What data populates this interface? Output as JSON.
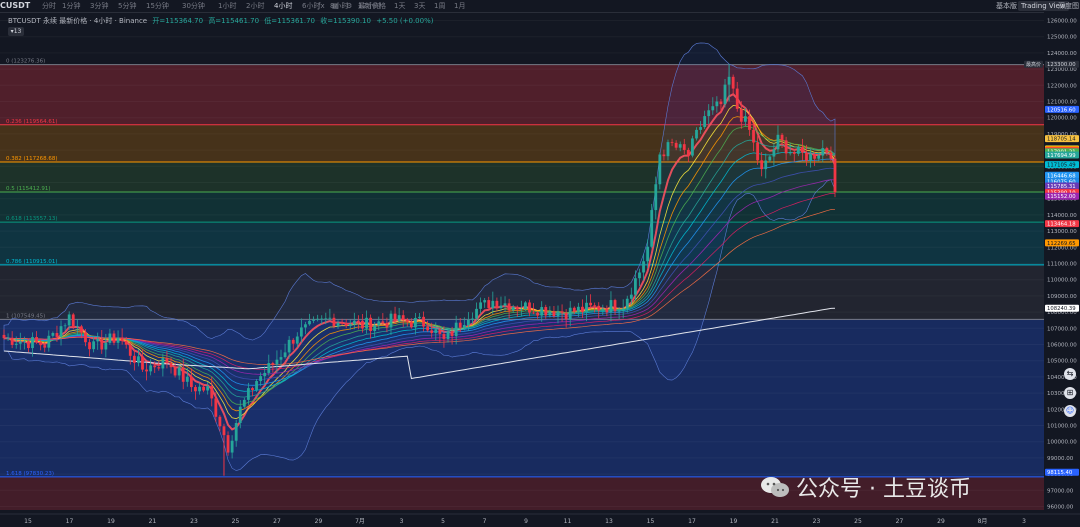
{
  "topbar": {
    "symbol": "CUSDT",
    "timeframes": [
      "分时",
      "1分钟",
      "3分钟",
      "5分钟",
      "15分钟",
      "30分钟",
      "1小时",
      "2小时",
      "4小时",
      "6小时",
      "8小时",
      "12小时",
      "1天",
      "3天",
      "1周",
      "1月"
    ],
    "active_timeframe": "4小时",
    "latest_price_menu": "最新价格",
    "right_basic": "基本版",
    "right_tradingview": "Trading View",
    "right_depth": "深度图"
  },
  "legend": {
    "pair": "BTCUSDT 永续 最新价格 · 4小时 · Binance",
    "open": "开=115364.70",
    "high": "高=115461.70",
    "low": "低=115361.70",
    "close": "收=115390.10",
    "change": "+5.50 (+0.00%)",
    "indicator_count": "13"
  },
  "fib_labels": [
    {
      "text": "0 (123276.36)",
      "price": 123276.36,
      "color": "#787b86"
    },
    {
      "text": "0.236 (119564.61)",
      "price": 119564.61,
      "color": "#f23645"
    },
    {
      "text": "0.382 (117268.68)",
      "price": 117268.68,
      "color": "#ff9800"
    },
    {
      "text": "0.5 (115412.91)",
      "price": 115412.91,
      "color": "#4caf50"
    },
    {
      "text": "0.618 (113557.13)",
      "price": 113557.13,
      "color": "#089981"
    },
    {
      "text": "0.786 (110915.01)",
      "price": 110915.01,
      "color": "#00bcd4"
    },
    {
      "text": "1 (107549.45)",
      "price": 107549.45,
      "color": "#787b86"
    },
    {
      "text": "1.618 (97830.23)",
      "price": 97830.23,
      "color": "#2962ff"
    }
  ],
  "price_scale": {
    "ticks": [
      "126000.00",
      "125000.00",
      "124000.00",
      "123000.00",
      "122000.00",
      "121000.00",
      "120000.00",
      "119000.00",
      "118000.00",
      "117000.00",
      "116000.00",
      "115000.00",
      "114000.00",
      "113000.00",
      "112000.00",
      "111000.00",
      "110000.00",
      "109000.00",
      "108000.00",
      "107000.00",
      "106000.00",
      "105000.00",
      "104000.00",
      "103000.00",
      "102000.00",
      "101000.00",
      "100000.00",
      "99000.00",
      "98000.00",
      "97000.00",
      "96000.00"
    ],
    "tick_prices": [
      126000,
      125000,
      124000,
      123000,
      122000,
      121000,
      120000,
      119000,
      118000,
      117000,
      116000,
      115000,
      114000,
      113000,
      112000,
      111000,
      110000,
      109000,
      108000,
      107000,
      106000,
      105000,
      104000,
      103000,
      102000,
      101000,
      100000,
      99000,
      98000,
      97000,
      96000
    ],
    "max_label": "最高价",
    "badges": [
      {
        "text": "123300.00",
        "price": 123300.0,
        "bg": "#2a2e39",
        "fg": "#d1d4dc"
      },
      {
        "text": "120516.60",
        "price": 120516.6,
        "bg": "#2962ff",
        "fg": "#ffffff"
      },
      {
        "text": "118705.14",
        "price": 118705.14,
        "bg": "#f7c242",
        "fg": "#131722"
      },
      {
        "text": "118065.15",
        "price": 118065.15,
        "bg": "#ffeb3b",
        "fg": "#131722"
      },
      {
        "text": "118036.35",
        "price": 118036.35,
        "bg": "#ff9800",
        "fg": "#131722"
      },
      {
        "text": "117959.65",
        "price": 117959.65,
        "bg": "#f23645",
        "fg": "#ffffff"
      },
      {
        "text": "117901.21",
        "price": 117901.21,
        "bg": "#4caf50",
        "fg": "#ffffff"
      },
      {
        "text": "117694.99",
        "price": 117694.99,
        "bg": "#26a69a",
        "fg": "#ffffff"
      },
      {
        "text": "117105.49",
        "price": 117105.49,
        "bg": "#00bcd4",
        "fg": "#131722"
      },
      {
        "text": "116446.68",
        "price": 116446.68,
        "bg": "#2196f3",
        "fg": "#ffffff"
      },
      {
        "text": "116075.60",
        "price": 116075.6,
        "bg": "#1e88e5",
        "fg": "#ffffff"
      },
      {
        "text": "115785.31",
        "price": 115785.31,
        "bg": "#673ab7",
        "fg": "#ffffff"
      },
      {
        "text": "115390.10",
        "price": 115390.1,
        "bg": "#f23645",
        "fg": "#ffffff"
      },
      {
        "text": "115152.00",
        "price": 115152.0,
        "bg": "#9c27b0",
        "fg": "#ffffff"
      },
      {
        "text": "113464.18",
        "price": 113464.18,
        "bg": "#f23645",
        "fg": "#ffffff"
      },
      {
        "text": "112269.65",
        "price": 112269.65,
        "bg": "#ff9800",
        "fg": "#131722"
      },
      {
        "text": "108240.39",
        "price": 108240.39,
        "bg": "#ffffff",
        "fg": "#131722"
      },
      {
        "text": "98115.40",
        "price": 98115.4,
        "bg": "#2962ff",
        "fg": "#ffffff"
      }
    ]
  },
  "time_axis": [
    "15",
    "17",
    "19",
    "21",
    "23",
    "25",
    "27",
    "29",
    "7月",
    "3",
    "5",
    "7",
    "9",
    "11",
    "13",
    "15",
    "17",
    "19",
    "21",
    "23",
    "25",
    "27",
    "29",
    "8月",
    "3"
  ],
  "watermark": "公众号 · 土豆谈币",
  "colors": {
    "bg": "#131722",
    "up": "#26a69a",
    "down": "#f23645",
    "fast_ma": "#f7525f",
    "long_ma": "#e0e3eb"
  }
}
